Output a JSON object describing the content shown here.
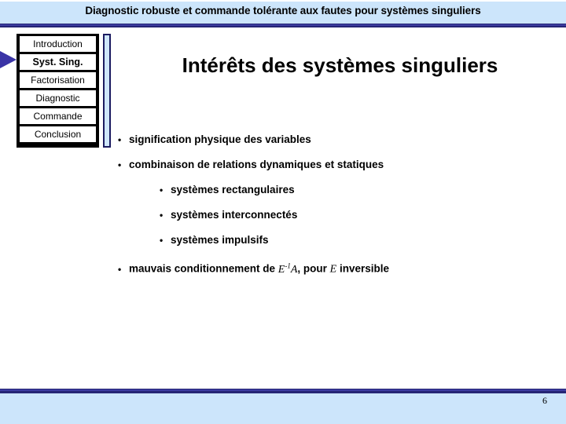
{
  "header": {
    "title": "Diagnostic robuste et commande tolérante aux fautes pour systèmes singuliers",
    "band_color": "#cce5fb",
    "rule_color": "#252575"
  },
  "sidebar": {
    "pointer_color": "#3a34a6",
    "active_index": 1,
    "items": [
      {
        "label": "Introduction",
        "active": false
      },
      {
        "label": "Syst. Sing.",
        "active": true
      },
      {
        "label": "Factorisation",
        "active": false
      },
      {
        "label": "Diagnostic",
        "active": false
      },
      {
        "label": "Commande",
        "active": false
      },
      {
        "label": "Conclusion",
        "active": false
      }
    ]
  },
  "slide": {
    "title": "Intérêts des systèmes singuliers",
    "bullet_glyph": "•",
    "bullets": [
      {
        "level": 1,
        "text_before": "signification physique des variables",
        "emphasis": "",
        "text_after": ""
      },
      {
        "level": 1,
        "text_before": "combinaison de relations dynamiques ",
        "emphasis": "et",
        "text_after": " statiques"
      },
      {
        "level": 2,
        "text_before": "systèmes rectangulaires",
        "emphasis": "",
        "text_after": ""
      },
      {
        "level": 2,
        "text_before": "systèmes interconnectés",
        "emphasis": "",
        "text_after": ""
      },
      {
        "level": 2,
        "text_before": "systèmes impulsifs",
        "emphasis": "",
        "text_after": ""
      }
    ],
    "last_bullet": {
      "prefix": "mauvais conditionnement de ",
      "math1_base": "E",
      "math1_exp": "-1",
      "math1_tail": "A",
      "middle": ", pour ",
      "math2": "E",
      "suffix": " inversible"
    }
  },
  "footer": {
    "page_number": "6",
    "band_color": "#cce5fb",
    "rule_color": "#252575"
  }
}
